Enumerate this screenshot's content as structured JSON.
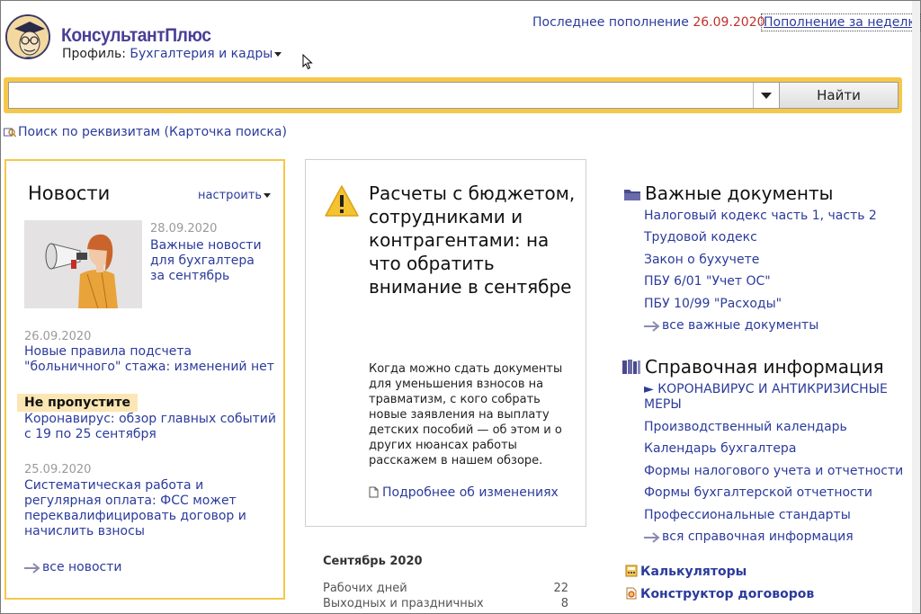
{
  "header": {
    "brand": "КонсультантПлюс",
    "profile_label": "Профиль:",
    "profile_value": "Бухгалтерия и кадры",
    "last_update_label": "Последнее пополнение",
    "last_update_date": "26.09.2020",
    "week_link": "Пополнение за неделю"
  },
  "search": {
    "value": "",
    "find_button": "Найти",
    "requisites_link": "Поиск по реквизитам (Карточка поиска)"
  },
  "news": {
    "title": "Новости",
    "configure": "настроить",
    "items": [
      {
        "date": "28.09.2020",
        "text": "Важные новости для бухгалтера за сентябрь"
      },
      {
        "date": "26.09.2020",
        "text": "Новые правила подсчета \"больничного\" стажа: изменений нет"
      },
      {
        "badge": "Не пропустите",
        "text": "Коронавирус: обзор главных событий с 19 по 25 сентября"
      },
      {
        "date": "25.09.2020",
        "text": "Систематическая работа и регулярная оплата: ФСС может переквалифицировать договор и начислить взносы"
      }
    ],
    "all_news": "все новости"
  },
  "article": {
    "title": "Расчеты с бюджетом, сотрудниками и контрагентами: на что обратить внимание в сентябре",
    "text": "Когда можно сдать документы для уменьшения взносов на травматизм, с кого собрать новые заявления на выплату детских пособий — об этом и о других нюансах работы расскажем в нашем обзоре.",
    "more_link": "Подробнее об изменениях"
  },
  "calendar": {
    "title": "Сентябрь 2020",
    "rows": [
      {
        "label": "Рабочих дней",
        "value": "22"
      },
      {
        "label": "Выходных и праздничных",
        "value": "8"
      }
    ]
  },
  "important_docs": {
    "title": "Важные документы",
    "items": [
      "Налоговый кодекс часть 1, часть 2",
      "Трудовой кодекс",
      "Закон о бухучете",
      "ПБУ 6/01 \"Учет ОС\"",
      "ПБУ 10/99 \"Расходы\""
    ],
    "all": "все важные документы"
  },
  "reference": {
    "title": "Справочная информация",
    "items": [
      "► КОРОНАВИРУС И АНТИКРИЗИСНЫЕ МЕРЫ",
      "Производственный календарь",
      "Календарь бухгалтера",
      "Формы налогового учета и отчетности",
      "Формы бухгалтерской отчетности",
      "Профессиональные стандарты"
    ],
    "all": "вся справочная информация"
  },
  "tools": {
    "calculators": "Калькуляторы",
    "contract_builder": "Конструктор договоров"
  },
  "colors": {
    "accent": "#f5c84a",
    "link": "#2b3b9c",
    "date_red": "#c0302a",
    "brand": "#4a3f96",
    "badge_bg": "#fbe6b4"
  }
}
